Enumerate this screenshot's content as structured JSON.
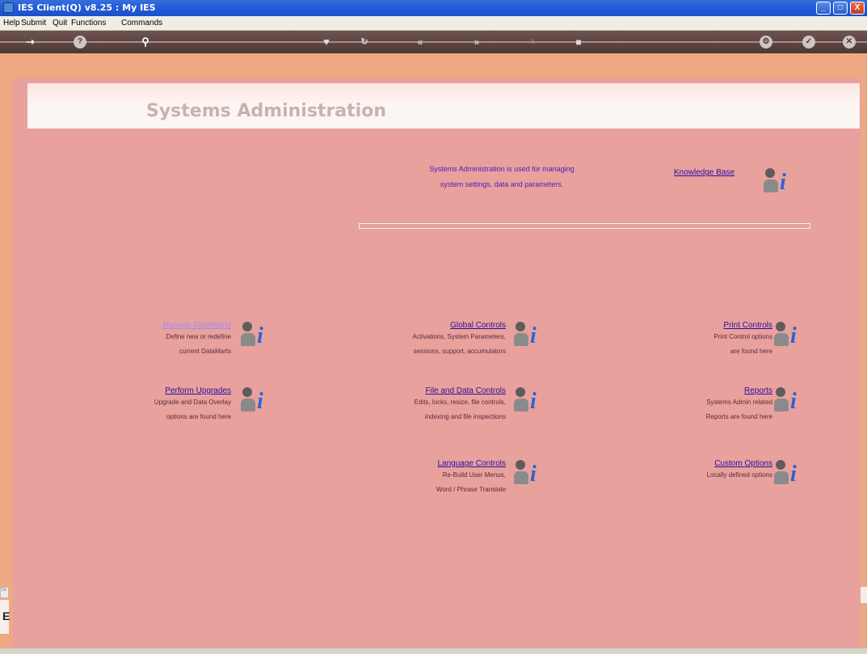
{
  "window": {
    "title": "IES Client(Q) v8.25 : My IES",
    "buttons": {
      "minimize": "_",
      "maximize": "□",
      "close": "X"
    }
  },
  "menu": {
    "items": [
      "Help",
      "Submit",
      "Quit",
      "Functions",
      "Commands"
    ]
  },
  "toolbar": {
    "icons": [
      "arrow-right-icon",
      "help-icon",
      "search-icon",
      "heart-icon",
      "refresh-icon",
      "rewind-icon",
      "forward-icon",
      "up-icon",
      "stop-icon",
      "gear-icon",
      "check-icon",
      "close-icon"
    ]
  },
  "page": {
    "title": "Systems Administration",
    "intro_line1": "Systems Administration is used for managing",
    "intro_line2": "system settings, data and parameters."
  },
  "knowledge_base": {
    "label": "Knowledge Base"
  },
  "modules": {
    "datamarts": {
      "label": "Manage DataMarts",
      "desc1": "Define new or redefine",
      "desc2": "current DataMarts"
    },
    "upgrades": {
      "label": "Perform Upgrades",
      "desc1": "Upgrade and Data Overlay",
      "desc2": "options are found here"
    },
    "global": {
      "label": "Global Controls",
      "desc1": "Activations, System Parameters,",
      "desc2": "sessions, support, accumulators"
    },
    "filedata": {
      "label": "File and Data Controls",
      "desc1": "Edits, locks, resize, file controls,",
      "desc2": "indexing and file inspections"
    },
    "language": {
      "label": "Language Controls",
      "desc1": "Re-Build User Menus,",
      "desc2": "Word / Phrase Translate"
    },
    "print": {
      "label": "Print Controls",
      "desc1": "Print Control options",
      "desc2": "are found here"
    },
    "reports": {
      "label": "Reports",
      "desc1": "Systems Admin related",
      "desc2": "Reports are found here"
    },
    "custom": {
      "label": "Custom Options",
      "desc1": "Locally defined options"
    }
  },
  "left_edge": {
    "small": "Se",
    "letter": "E"
  },
  "colors": {
    "panel": "#e9a19d",
    "border": "#f0a882",
    "link": "#2a0ea0",
    "visited_link": "#9b8ef0",
    "info_icon": "#2a62d6",
    "titlebar": "#245edb"
  }
}
